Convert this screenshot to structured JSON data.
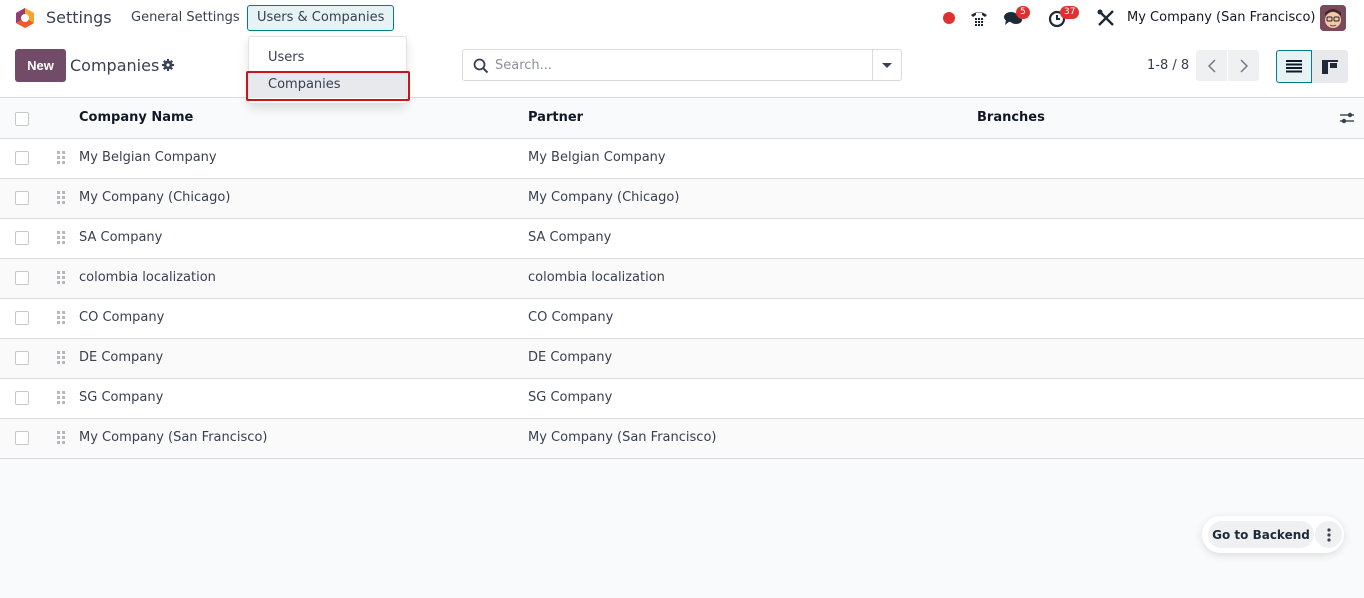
{
  "navbar": {
    "app_title": "Settings",
    "menus": [
      {
        "label": "General Settings",
        "active": false
      },
      {
        "label": "Users & Companies",
        "active": true
      }
    ],
    "systray": {
      "recording_indicator": "red-dot",
      "phone_icon": "phone-icon",
      "messages_badge": "5",
      "activities_badge": "37",
      "tools_icon": "debug-tools-icon",
      "company_switcher": "My Company (San Francisco)"
    }
  },
  "dropdown": {
    "items": [
      {
        "label": "Users",
        "highlighted": false
      },
      {
        "label": "Companies",
        "highlighted": true
      }
    ]
  },
  "control_panel": {
    "new_label": "New",
    "title": "Companies",
    "search_placeholder": "Search...",
    "search_value": "",
    "pager": "1-8 / 8",
    "views": [
      {
        "name": "list",
        "active": true
      },
      {
        "name": "kanban",
        "active": false
      }
    ]
  },
  "table": {
    "columns": [
      "Company Name",
      "Partner",
      "Branches"
    ],
    "rows": [
      {
        "company_name": "My Belgian Company",
        "partner": "My Belgian Company",
        "branches": ""
      },
      {
        "company_name": "My Company (Chicago)",
        "partner": "My Company (Chicago)",
        "branches": ""
      },
      {
        "company_name": "SA Company",
        "partner": "SA Company",
        "branches": ""
      },
      {
        "company_name": "colombia localization",
        "partner": "colombia localization",
        "branches": ""
      },
      {
        "company_name": "CO Company",
        "partner": "CO Company",
        "branches": ""
      },
      {
        "company_name": "DE Company",
        "partner": "DE Company",
        "branches": ""
      },
      {
        "company_name": "SG Company",
        "partner": "SG Company",
        "branches": ""
      },
      {
        "company_name": "My Company (San Francisco)",
        "partner": "My Company (San Francisco)",
        "branches": ""
      }
    ]
  },
  "floating": {
    "go_to_backend_label": "Go to Backend"
  },
  "colors": {
    "brand": "#714b67",
    "accent": "#017e84",
    "badge": "#e03131",
    "highlight_box": "#c4161c"
  }
}
